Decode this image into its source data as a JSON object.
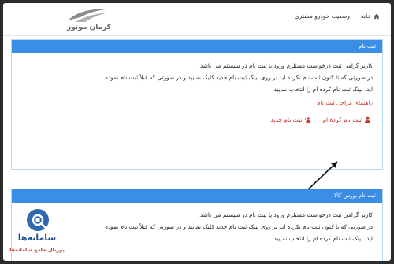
{
  "header": {
    "logo_text": "کرمان موتور",
    "nav": [
      {
        "label": "خانه",
        "icon": "home-icon"
      },
      {
        "label": "وضعیت خودرو مشتری"
      }
    ]
  },
  "panel1": {
    "title": "ثبت نام",
    "line1": "کاربر گرامی ثبت درخواست مستلزم ورود یا ثبت نام در سیستم می باشد.",
    "line2": "در صورتی که تا کنون ثبت نام نکرده اید بر روی لینک ثبت نام جدید کلیک نمایید و در صورتی که قبلاً ثبت نام نموده",
    "line3": "اید، لینک ثبت نام کرده ام را انتخاب نمایید.",
    "guide": "راهنمای مراحل ثبت نام",
    "registered_label": "ثبت نام کرده ام",
    "new_label": "ثبت نام جدید"
  },
  "panel2": {
    "title": "ثبت نام بورس کالا",
    "line1": "کاربر گرامی ثبت درخواست مستلزم ورود یا ثبت نام در سیستم می باشد.",
    "line2": "در صورتی که تا کنون ثبت نام نکرده اید بر روی لینک ثبت نام جدید کلیک نمایید و در صورتی که قبلاً ثبت نام نموده",
    "line3": "اید، لینک ثبت نام کرده ام را انتخاب نمایید."
  },
  "watermark": {
    "brand": "سامانه‌ها",
    "sub": "پورتال جامع سامانه‌ها"
  },
  "colors": {
    "panel_header": "#3a8ee6",
    "link_red": "#c9302c",
    "panel_border": "#b9d8f2"
  }
}
